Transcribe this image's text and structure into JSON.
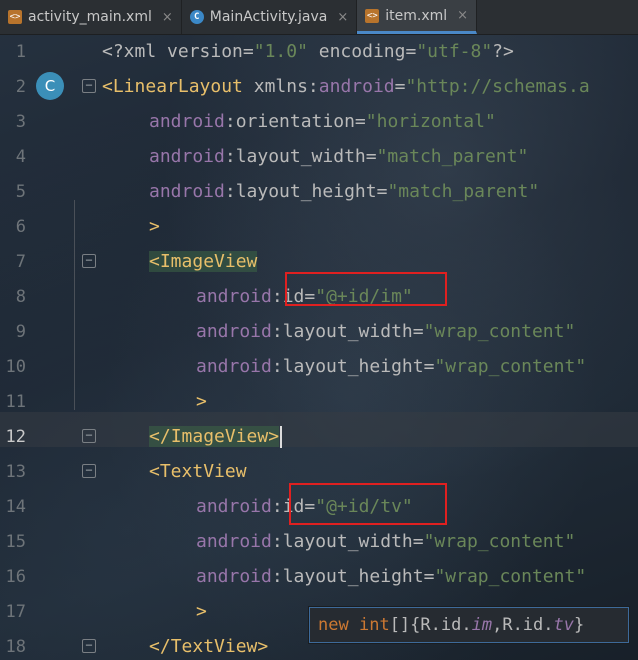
{
  "tabs": [
    {
      "name": "activity_main.xml",
      "icon": "xml-file-icon",
      "icon_glyph": "<>",
      "active": false
    },
    {
      "name": "MainActivity.java",
      "icon": "java-class-icon",
      "icon_glyph": "C",
      "active": false
    },
    {
      "name": "item.xml",
      "icon": "xml-file-icon",
      "icon_glyph": "<>",
      "active": true
    }
  ],
  "tab_close_glyph": "×",
  "gutter": {
    "line_numbers": [
      "1",
      "2",
      "3",
      "4",
      "5",
      "6",
      "7",
      "8",
      "9",
      "10",
      "11",
      "12",
      "13",
      "14",
      "15",
      "16",
      "17",
      "18"
    ],
    "current_line": "12",
    "class_badge": "C",
    "fold_minus": "−"
  },
  "code": {
    "l1": {
      "decl_open": "<?xml",
      "a1": " version",
      "eq1": "=",
      "v1": "\"1.0\"",
      "a2": " encoding",
      "eq2": "=",
      "v2": "\"utf-8\"",
      "decl_close": "?>"
    },
    "l2": {
      "open": "<",
      "tag": "LinearLayout",
      "a1": " xmlns",
      "colon": ":",
      "a2": "android",
      "eq": "=",
      "val": "\"http://schemas.a"
    },
    "l3": {
      "ns": "android",
      "colon": ":",
      "attr": "orientation",
      "eq": "=",
      "val": "\"horizontal\""
    },
    "l4": {
      "ns": "android",
      "colon": ":",
      "attr": "layout_width",
      "eq": "=",
      "val": "\"match_parent\""
    },
    "l5": {
      "ns": "android",
      "colon": ":",
      "attr": "layout_height",
      "eq": "=",
      "val": "\"match_parent\""
    },
    "l6": {
      "close": ">"
    },
    "l7": {
      "open": "<",
      "tag": "ImageView"
    },
    "l8": {
      "ns": "android",
      "colon": ":",
      "attr": "id",
      "eq": "=",
      "val": "\"@+id/im\""
    },
    "l9": {
      "ns": "android",
      "colon": ":",
      "attr": "layout_width",
      "eq": "=",
      "val": "\"wrap_content\""
    },
    "l10": {
      "ns": "android",
      "colon": ":",
      "attr": "layout_height",
      "eq": "=",
      "val": "\"wrap_content\""
    },
    "l11": {
      "close": ">"
    },
    "l12": {
      "open": "</",
      "tag": "ImageView",
      "close": ">"
    },
    "l13": {
      "open": "<",
      "tag": "TextView"
    },
    "l14": {
      "ns": "android",
      "colon": ":",
      "attr": "id",
      "eq": "=",
      "val": "\"@+id/tv\""
    },
    "l15": {
      "ns": "android",
      "colon": ":",
      "attr": "layout_width",
      "eq": "=",
      "val": "\"wrap_content\""
    },
    "l16": {
      "ns": "android",
      "colon": ":",
      "attr": "layout_height",
      "eq": "=",
      "val": "\"wrap_content\""
    },
    "l17": {
      "close": ">"
    },
    "l18": {
      "open": "</",
      "tag": "TextView",
      "close": ">"
    }
  },
  "hint": {
    "kw_new": "new",
    "kw_int": "int",
    "brackets": "[]{",
    "r1": "R.id.",
    "f1": "im",
    "comma": ",",
    "r2": "R.id.",
    "f2": "tv",
    "end": "}"
  },
  "colors": {
    "highlight_box": "#e02020",
    "tag": "#e8bf6a",
    "namespace": "#9876aa",
    "string": "#6a8759",
    "keyword": "#cc7832"
  }
}
